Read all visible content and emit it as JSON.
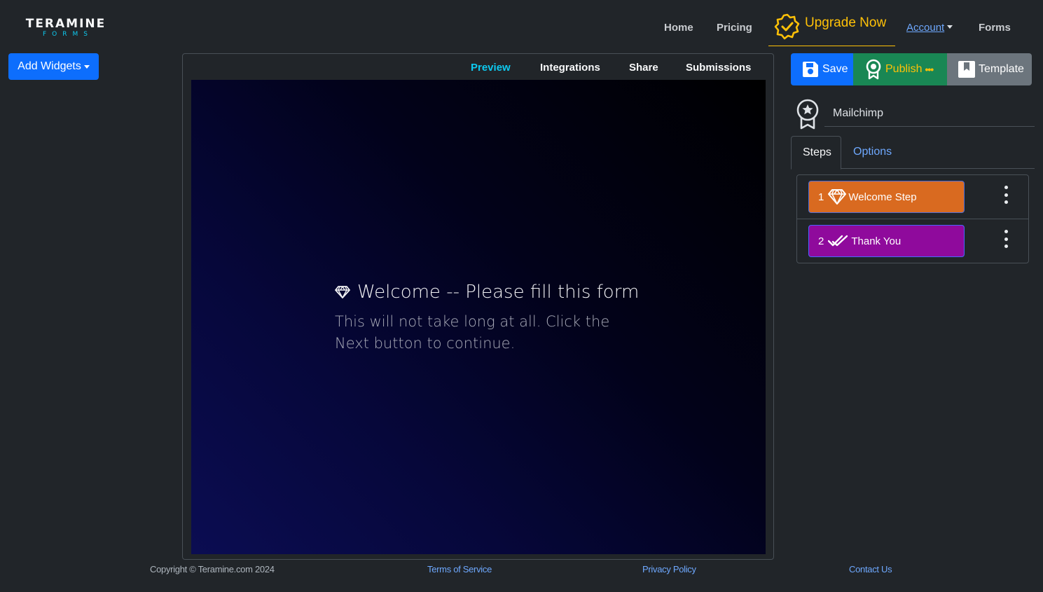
{
  "brand": {
    "name": "TERAMINE",
    "sub": "FORMS"
  },
  "nav": {
    "home": "Home",
    "pricing": "Pricing",
    "upgrade": "Upgrade Now",
    "account": "Account",
    "forms": "Forms"
  },
  "toolbar": {
    "add_widgets": "Add Widgets"
  },
  "preview_tabs": {
    "preview": "Preview",
    "integrations": "Integrations",
    "share": "Share",
    "submissions": "Submissions"
  },
  "form_preview": {
    "title": "Welcome -- Please fill this form",
    "description": "This will not take long at all. Click the Next button to continue.",
    "background_colors": [
      "#0b0d52",
      "#000000"
    ]
  },
  "actions": {
    "save": "Save",
    "publish": "Publish",
    "template": "Template"
  },
  "integration": {
    "name": "Mailchimp",
    "icon": "award-icon"
  },
  "side_tabs": {
    "steps": "Steps",
    "options": "Options"
  },
  "steps": [
    {
      "number": "1",
      "label": "Welcome Step",
      "icon": "gem-icon",
      "color": "#d96a20"
    },
    {
      "number": "2",
      "label": "Thank You",
      "icon": "check-all-icon",
      "color": "#8f0a9c"
    }
  ],
  "footer": {
    "copyright": "Copyright © Teramine.com 2024",
    "terms": "Terms of Service",
    "privacy": "Privacy Policy",
    "contact": "Contact Us"
  },
  "colors": {
    "primary": "#0d6efd",
    "success": "#198754",
    "warning": "#ffc107",
    "secondary": "#6c757d",
    "info": "#0dcaf0"
  }
}
